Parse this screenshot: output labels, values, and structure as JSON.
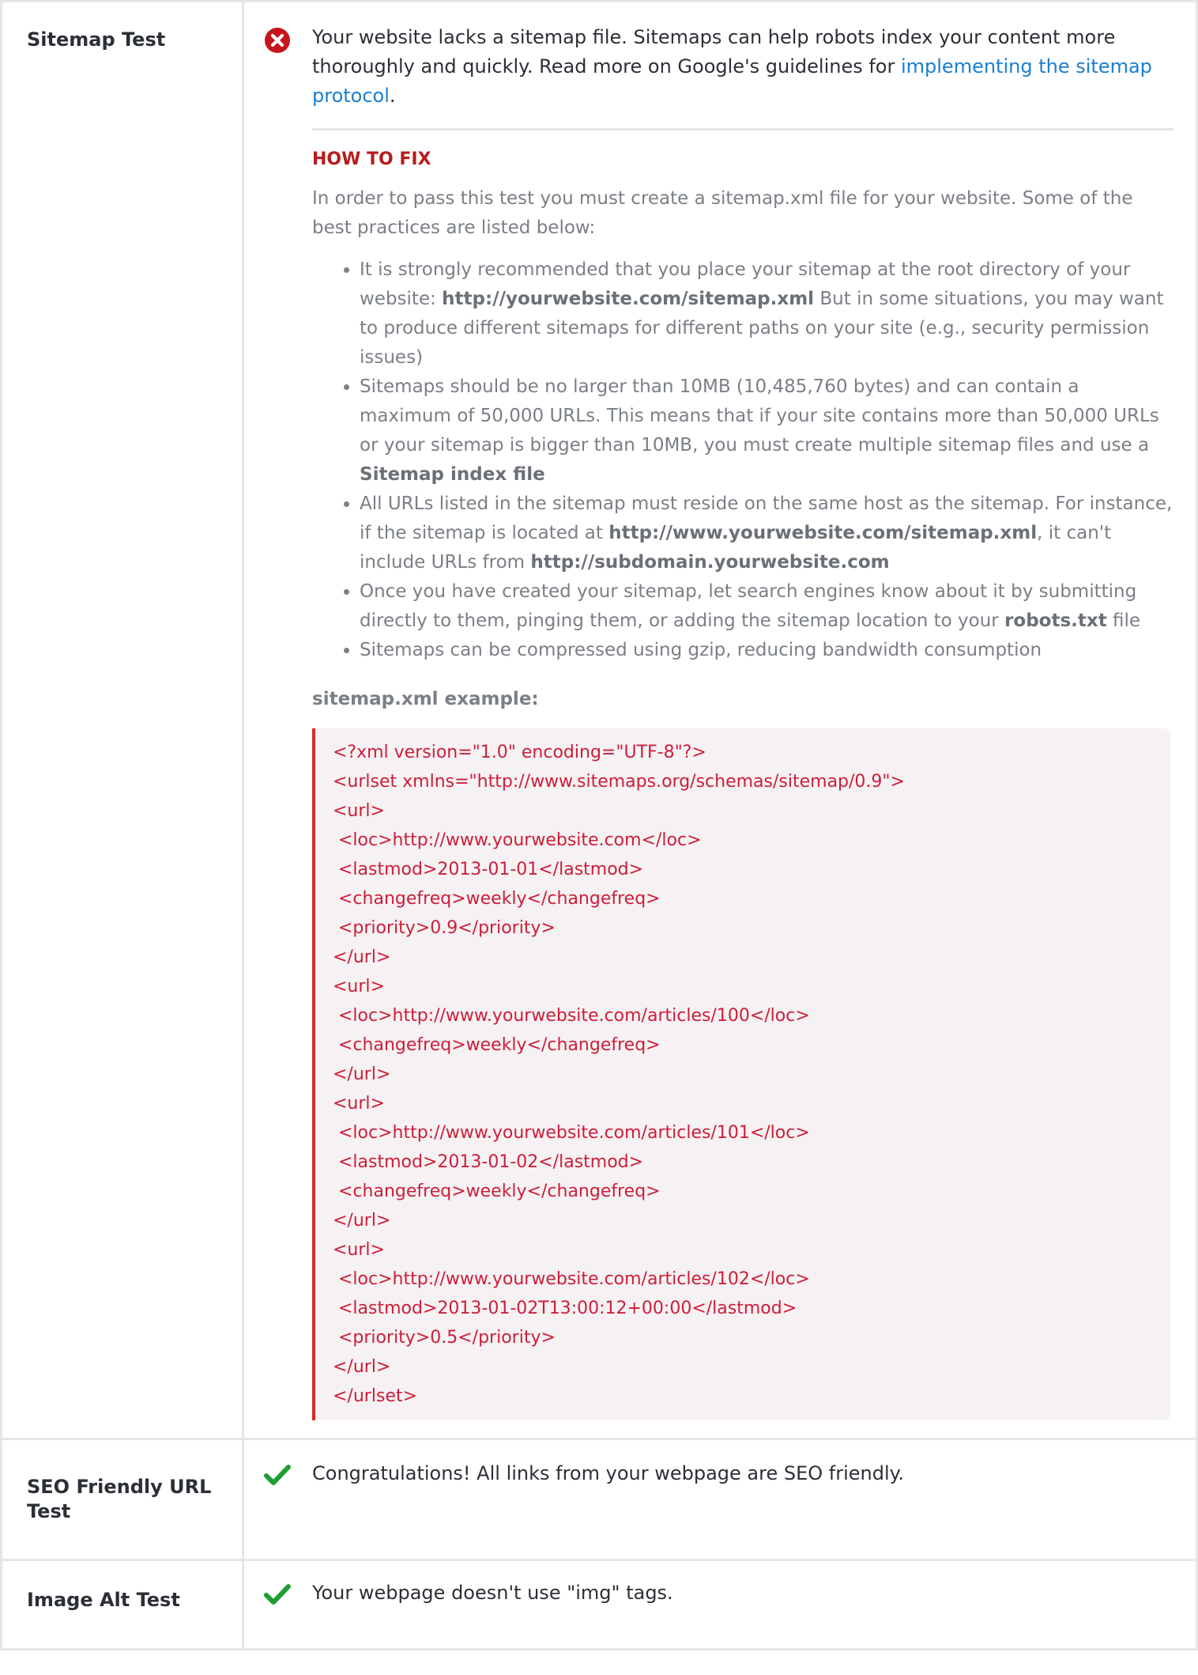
{
  "tests": {
    "sitemap": {
      "label": "Sitemap Test",
      "status": "fail",
      "message_prefix": "Your website lacks a sitemap file. Sitemaps can help robots index your content more thoroughly and quickly. Read more on Google's guidelines for ",
      "message_link": "implementing the sitemap protocol",
      "message_suffix": ".",
      "fix_title": "HOW TO FIX",
      "fix_intro": "In order to pass this test you must create a sitemap.xml file for your website. Some of the best practices are listed below:",
      "practices": {
        "p1_a": "It is strongly recommended that you place your sitemap at the root directory of your website: ",
        "p1_b": "http://yourwebsite.com/sitemap.xml",
        "p1_c": " But in some situations, you may want to produce different sitemaps for different paths on your site (e.g., security permission issues)",
        "p2_a": "Sitemaps should be no larger than 10MB (10,485,760 bytes) and can contain a maximum of 50,000 URLs. This means that if your site contains more than 50,000 URLs or your sitemap is bigger than 10MB, you must create multiple sitemap files and use a ",
        "p2_b": "Sitemap index file",
        "p3_a": "All URLs listed in the sitemap must reside on the same host as the sitemap. For instance, if the sitemap is located at ",
        "p3_b": "http://www.yourwebsite.com/sitemap.xml",
        "p3_c": ", it can't include URLs from ",
        "p3_d": "http://subdomain.yourwebsite.com",
        "p4_a": "Once you have created your sitemap, let search engines know about it by submitting directly to them, pinging them, or adding the sitemap location to your ",
        "p4_b": "robots.txt",
        "p4_c": " file",
        "p5": "Sitemaps can be compressed using gzip, reducing bandwidth consumption"
      },
      "example_title": "sitemap.xml example:",
      "code_lines": [
        "<?xml version=\"1.0\" encoding=\"UTF-8\"?>",
        "<urlset xmlns=\"http://www.sitemaps.org/schemas/sitemap/0.9\">",
        "<url>",
        " <loc>http://www.yourwebsite.com</loc>",
        " <lastmod>2013-01-01</lastmod>",
        " <changefreq>weekly</changefreq>",
        " <priority>0.9</priority>",
        "</url>",
        "<url>",
        " <loc>http://www.yourwebsite.com/articles/100</loc>",
        " <changefreq>weekly</changefreq>",
        "</url>",
        "<url>",
        " <loc>http://www.yourwebsite.com/articles/101</loc>",
        " <lastmod>2013-01-02</lastmod>",
        " <changefreq>weekly</changefreq>",
        "</url>",
        "<url>",
        " <loc>http://www.yourwebsite.com/articles/102</loc>",
        " <lastmod>2013-01-02T13:00:12+00:00</lastmod>",
        " <priority>0.5</priority>",
        "</url>",
        "</urlset>"
      ]
    },
    "seo_url": {
      "label": "SEO Friendly URL Test",
      "status": "pass",
      "message": "Congratulations! All links from your webpage are SEO friendly."
    },
    "image_alt": {
      "label": "Image Alt Test",
      "status": "pass",
      "message": "Your webpage doesn't use \"img\" tags."
    }
  },
  "icons": {
    "fail": "close-circle-icon",
    "pass": "checkmark-icon"
  },
  "colors": {
    "fail": "#c4161c",
    "pass": "#1e9e34",
    "link": "#1a7ed0",
    "fix_title": "#b81c1c",
    "code_text": "#cc1e3a",
    "code_border": "#d92b2b",
    "code_bg": "#f6f1f3"
  }
}
